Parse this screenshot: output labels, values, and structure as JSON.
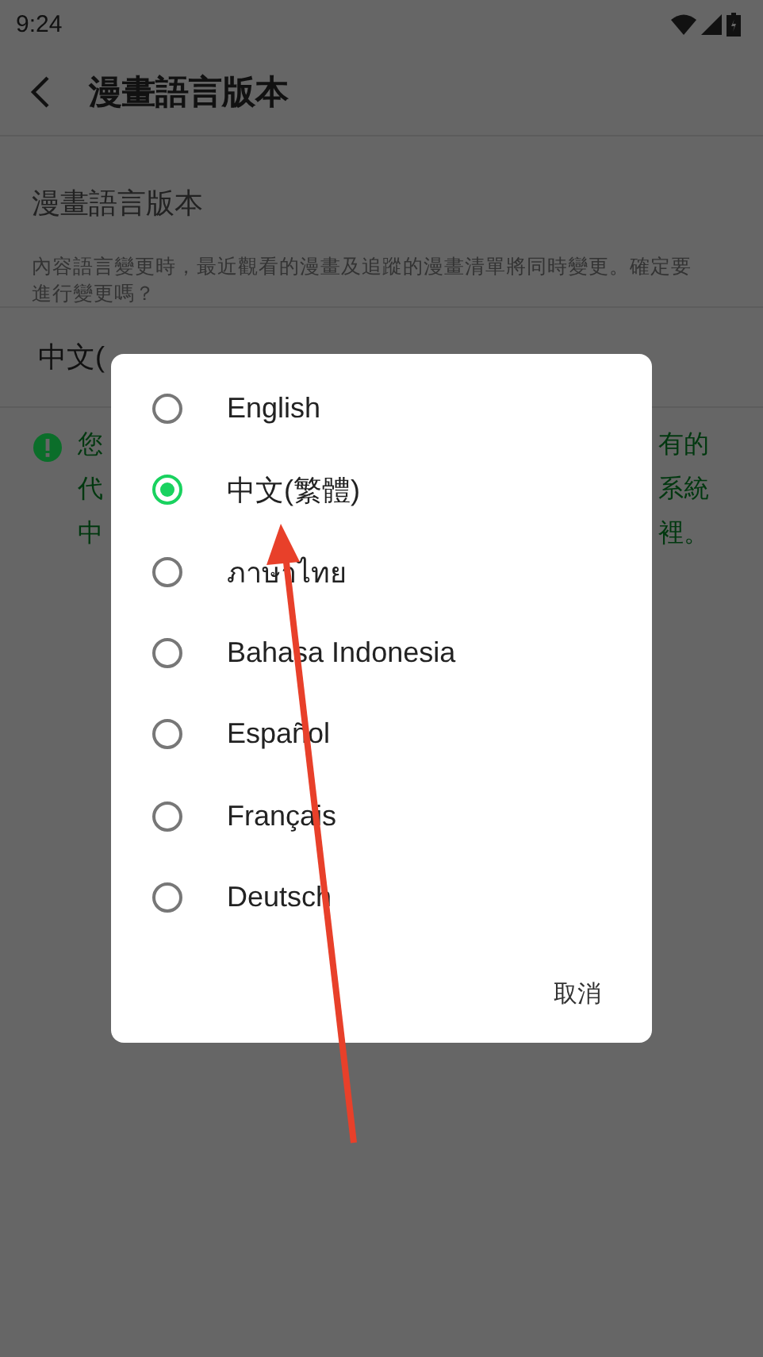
{
  "status_bar": {
    "time": "9:24"
  },
  "app_bar": {
    "title": "漫畫語言版本"
  },
  "section": {
    "title": "漫畫語言版本",
    "description": "內容語言變更時，最近觀看的漫畫及追蹤的漫畫清單將同時變更。確定要進行變更嗎？",
    "current_value": "中文("
  },
  "notice": {
    "lines": [
      {
        "left": "您",
        "right": "有的"
      },
      {
        "left": "代",
        "right": "系統"
      },
      {
        "left": "中",
        "right": "裡。"
      }
    ]
  },
  "dialog": {
    "options": [
      {
        "label": "English",
        "selected": false
      },
      {
        "label": "中文(繁體)",
        "selected": true
      },
      {
        "label": "ภาษาไทย",
        "selected": false
      },
      {
        "label": "Bahasa Indonesia",
        "selected": false
      },
      {
        "label": "Español",
        "selected": false
      },
      {
        "label": "Français",
        "selected": false
      },
      {
        "label": "Deutsch",
        "selected": false
      }
    ],
    "cancel": "取消"
  }
}
